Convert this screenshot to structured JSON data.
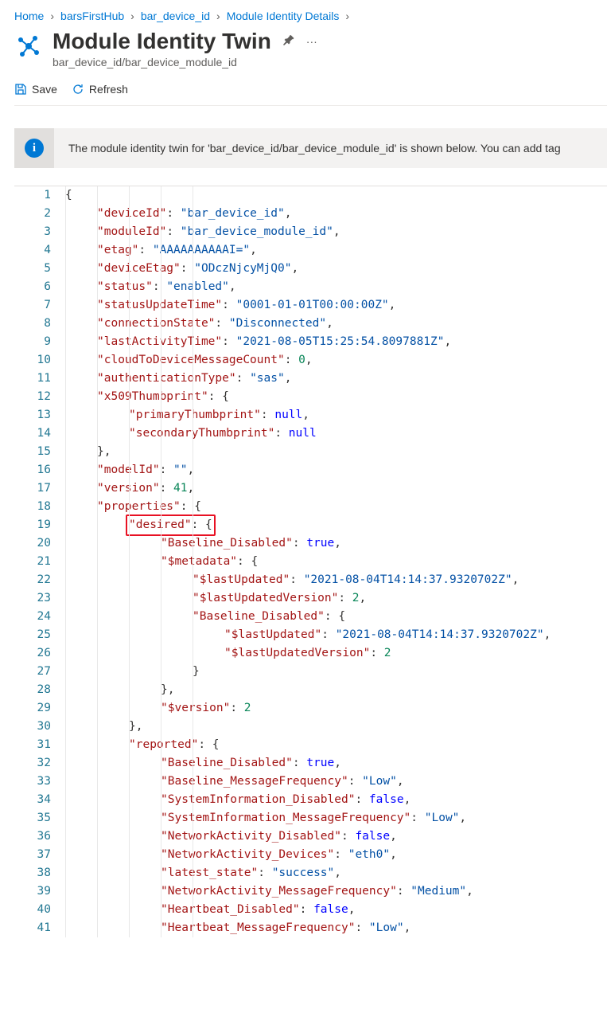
{
  "breadcrumb": [
    "Home",
    "barsFirstHub",
    "bar_device_id",
    "Module Identity Details"
  ],
  "title": "Module Identity Twin",
  "subtitle": "bar_device_id/bar_device_module_id",
  "toolbar": {
    "save": "Save",
    "refresh": "Refresh"
  },
  "info": "The module identity twin for 'bar_device_id/bar_device_module_id' is shown below. You can add tag",
  "json": {
    "deviceId": "bar_device_id",
    "moduleId": "bar_device_module_id",
    "etag": "AAAAAAAAAAI=",
    "deviceEtag": "ODczNjcyMjQ0",
    "status": "enabled",
    "statusUpdateTime": "0001-01-01T00:00:00Z",
    "connectionState": "Disconnected",
    "lastActivityTime": "2021-08-05T15:25:54.8097881Z",
    "cloudToDeviceMessageCount": 0,
    "authenticationType": "sas",
    "x509Thumbprint": {
      "primaryThumbprint": null,
      "secondaryThumbprint": null
    },
    "modelId": "",
    "version": 41,
    "properties": {
      "desired": {
        "Baseline_Disabled": true,
        "$metadata": {
          "$lastUpdated": "2021-08-04T14:14:37.9320702Z",
          "$lastUpdatedVersion": 2,
          "Baseline_Disabled": {
            "$lastUpdated": "2021-08-04T14:14:37.9320702Z",
            "$lastUpdatedVersion": 2
          }
        },
        "$version": 2
      },
      "reported": {
        "Baseline_Disabled": true,
        "Baseline_MessageFrequency": "Low",
        "SystemInformation_Disabled": false,
        "SystemInformation_MessageFrequency": "Low",
        "NetworkActivity_Disabled": false,
        "NetworkActivity_Devices": "eth0",
        "latest_state": "success",
        "NetworkActivity_MessageFrequency": "Medium",
        "Heartbeat_Disabled": false,
        "Heartbeat_MessageFrequency": "Low"
      }
    }
  },
  "highlightLine": 19,
  "lineCount": 41
}
